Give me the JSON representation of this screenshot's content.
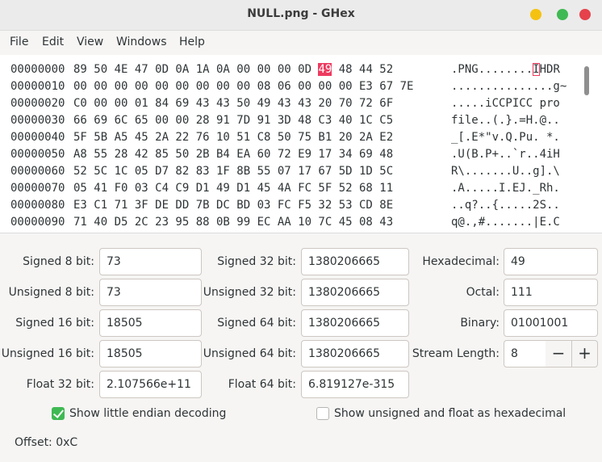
{
  "window": {
    "title": "NULL.png - GHex"
  },
  "menu": [
    "File",
    "Edit",
    "View",
    "Windows",
    "Help"
  ],
  "hex_rows": [
    {
      "offset": "00000000",
      "hex_pre": "89 50 4E 47 0D 0A 1A 0A 00 00 00 0D ",
      "hex_cur": "49",
      "hex_post": " 48 44 52",
      "ascii_pre": ".PNG........",
      "ascii_cur": "I",
      "ascii_post": "HDR"
    },
    {
      "offset": "00000010",
      "hex_pre": "00 00 00 00 00 00 00 00 00 08 06 00 00 00 E3 67 7E",
      "hex_cur": "",
      "hex_post": "",
      "ascii_pre": "...............g~",
      "ascii_cur": "",
      "ascii_post": ""
    },
    {
      "offset": "00000020",
      "hex_pre": "C0 00 00 01 84 69 43 43 50 49 43 43 20 70 72 6F",
      "hex_cur": "",
      "hex_post": "",
      "ascii_pre": ".....iCCPICC pro",
      "ascii_cur": "",
      "ascii_post": ""
    },
    {
      "offset": "00000030",
      "hex_pre": "66 69 6C 65 00 00 28 91 7D 91 3D 48 C3 40 1C C5",
      "hex_cur": "",
      "hex_post": "",
      "ascii_pre": "file..(.}.=H.@..",
      "ascii_cur": "",
      "ascii_post": ""
    },
    {
      "offset": "00000040",
      "hex_pre": "5F 5B A5 45 2A 22 76 10 51 C8 50 75 B1 20 2A E2",
      "hex_cur": "",
      "hex_post": "",
      "ascii_pre": "_[.E*\"v.Q.Pu. *.",
      "ascii_cur": "",
      "ascii_post": ""
    },
    {
      "offset": "00000050",
      "hex_pre": "A8 55 28 42 85 50 2B B4 EA 60 72 E9 17 34 69 48",
      "hex_cur": "",
      "hex_post": "",
      "ascii_pre": ".U(B.P+..`r..4iH",
      "ascii_cur": "",
      "ascii_post": ""
    },
    {
      "offset": "00000060",
      "hex_pre": "52 5C 1C 05 D7 82 83 1F 8B 55 07 17 67 5D 1D 5C",
      "hex_cur": "",
      "hex_post": "",
      "ascii_pre": "R\\.......U..g].\\",
      "ascii_cur": "",
      "ascii_post": ""
    },
    {
      "offset": "00000070",
      "hex_pre": "05 41 F0 03 C4 C9 D1 49 D1 45 4A FC 5F 52 68 11",
      "hex_cur": "",
      "hex_post": "",
      "ascii_pre": ".A.....I.EJ._Rh.",
      "ascii_cur": "",
      "ascii_post": ""
    },
    {
      "offset": "00000080",
      "hex_pre": "E3 C1 71 3F DE DD 7B DC BD 03 FC F5 32 53 CD 8E",
      "hex_cur": "",
      "hex_post": "",
      "ascii_pre": "..q?..{.....2S..",
      "ascii_cur": "",
      "ascii_post": ""
    },
    {
      "offset": "00000090",
      "hex_pre": "71 40 D5 2C 23 95 88 0B 99 EC AA 10 7C 45 08 43",
      "hex_cur": "",
      "hex_post": "",
      "ascii_pre": "q@.,#.......|E.C",
      "ascii_cur": "",
      "ascii_post": ""
    }
  ],
  "fields": {
    "signed8": {
      "label": "Signed 8 bit:",
      "value": "73"
    },
    "unsigned8": {
      "label": "Unsigned 8 bit:",
      "value": "73"
    },
    "signed16": {
      "label": "Signed 16 bit:",
      "value": "18505"
    },
    "unsigned16": {
      "label": "Unsigned 16 bit:",
      "value": "18505"
    },
    "float32": {
      "label": "Float 32 bit:",
      "value": "2.107566e+11"
    },
    "signed32": {
      "label": "Signed 32 bit:",
      "value": "1380206665"
    },
    "unsigned32": {
      "label": "Unsigned 32 bit:",
      "value": "1380206665"
    },
    "signed64": {
      "label": "Signed 64 bit:",
      "value": "1380206665"
    },
    "unsigned64": {
      "label": "Unsigned 64 bit:",
      "value": "1380206665"
    },
    "float64": {
      "label": "Float 64 bit:",
      "value": "6.819127e-315"
    },
    "hexadecimal": {
      "label": "Hexadecimal:",
      "value": "49"
    },
    "octal": {
      "label": "Octal:",
      "value": "111"
    },
    "binary": {
      "label": "Binary:",
      "value": "01001001"
    },
    "stream_length": {
      "label": "Stream Length:",
      "value": "8",
      "minus": "−",
      "plus": "+"
    }
  },
  "options": {
    "little_endian": {
      "label": "Show little endian decoding",
      "checked": true
    },
    "unsigned_hex": {
      "label": "Show unsigned and float as hexadecimal",
      "checked": false
    }
  },
  "status": {
    "offset_text": "Offset: 0xC"
  },
  "colors": {
    "cursor": "#ed3b5f",
    "check_on": "#3fb953"
  }
}
